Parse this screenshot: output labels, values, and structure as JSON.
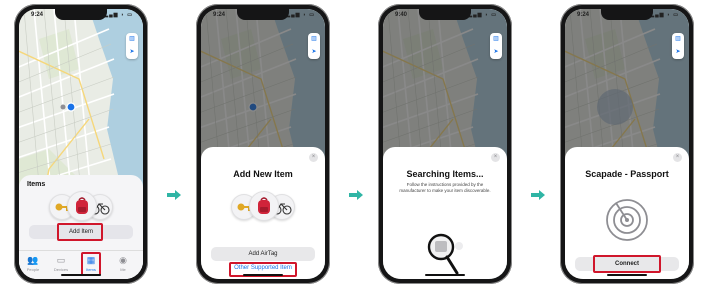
{
  "status_times": [
    "9:24",
    "9:24",
    "9:40",
    "9:24"
  ],
  "status_icons": "▂▄▆ ◗ ▭",
  "screen1": {
    "items_title": "Items",
    "add_item_label": "Add Item",
    "tabs": [
      {
        "icon": "👥",
        "label": "People"
      },
      {
        "icon": "▭",
        "label": "Devices"
      },
      {
        "icon": "▦",
        "label": "Items"
      },
      {
        "icon": "◉",
        "label": "Me"
      }
    ]
  },
  "screen2": {
    "title": "Add New Item",
    "add_airtag_label": "Add AirTag",
    "other_items_label": "Other Supported Item"
  },
  "screen3": {
    "title": "Searching Items...",
    "subtitle": "Follow the instructions provided by the manufacturer to make your item discoverable."
  },
  "screen4": {
    "title": "Scapade - Passport",
    "connect_label": "Connect"
  },
  "close_glyph": "×",
  "icons": {
    "map": "map-icon",
    "location": "location-arrow-icon",
    "keys": "key-icon",
    "backpack": "backpack-icon",
    "bicycle": "bicycle-icon",
    "magnifier": "magnifier-icon",
    "radar": "radar-icon",
    "step_arrow": "right-arrow-icon"
  },
  "colors": {
    "highlight": "#d0162b",
    "arrow": "#2fb5a5",
    "link": "#1a73e8",
    "water": "#aecfe0",
    "map_land": "#e9ece5"
  }
}
